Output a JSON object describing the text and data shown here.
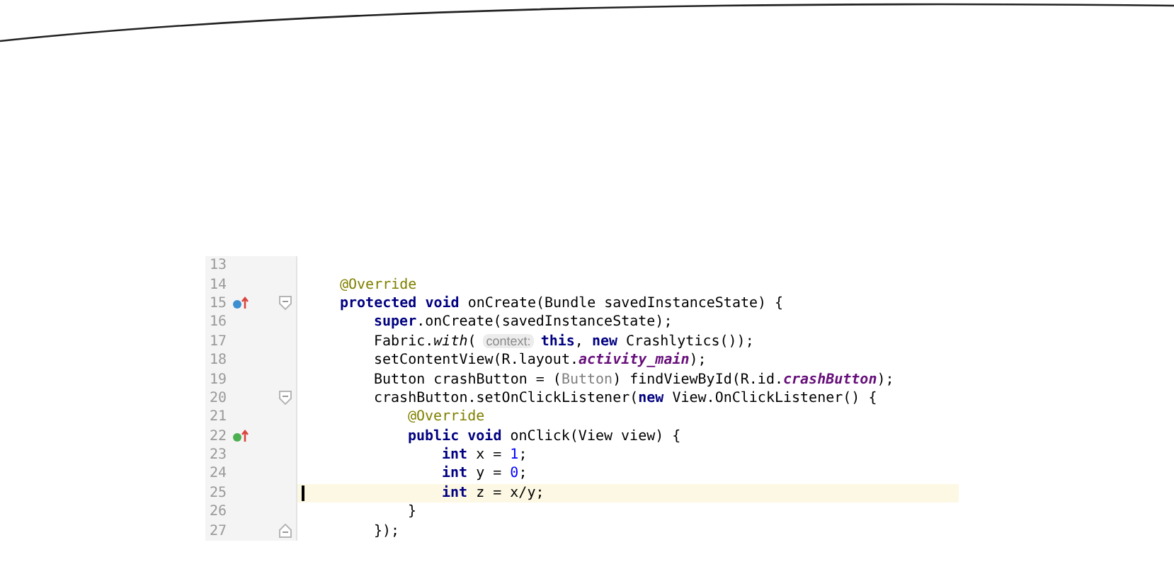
{
  "editor": {
    "lines": [
      {
        "number": "13",
        "current": false
      },
      {
        "number": "14",
        "current": false,
        "tokens": [
          {
            "kind": "annotation",
            "text": "@Override"
          }
        ]
      },
      {
        "number": "15",
        "current": false,
        "marker": {
          "color": "#3d8fd1"
        },
        "fold_marker": {
          "kind": "start"
        },
        "tokens": [
          {
            "kind": "keyword",
            "text": "protected void"
          },
          {
            "kind": "plain",
            "text": " onCreate(Bundle savedInstanceState) {"
          }
        ],
        "children": [
          {
            "number": "16",
            "current": false,
            "tokens": [
              {
                "kind": "keyword",
                "text": "super"
              },
              {
                "kind": "plain",
                "text": ".onCreate(savedInstanceState);"
              }
            ]
          },
          {
            "number": "17",
            "current": false,
            "tokens": [
              {
                "kind": "plain",
                "text": "Fabric."
              },
              {
                "kind": "static",
                "text": "with"
              },
              {
                "kind": "plain",
                "text": "("
              },
              {
                "kind": "hint",
                "text": "context:"
              },
              {
                "kind": "keyword",
                "text": "this"
              },
              {
                "kind": "plain",
                "text": ", "
              },
              {
                "kind": "keyword",
                "text": "new"
              },
              {
                "kind": "plain",
                "text": " Crashlytics());"
              }
            ]
          },
          {
            "number": "18",
            "current": false,
            "tokens": [
              {
                "kind": "plain",
                "text": "setContentView(R.layout."
              },
              {
                "kind": "field",
                "text": "activity_main"
              },
              {
                "kind": "plain",
                "text": ");"
              }
            ]
          },
          {
            "number": "19",
            "current": false,
            "tokens": [
              {
                "kind": "plain",
                "text": "Button crashButton = ("
              },
              {
                "kind": "muted",
                "text": "Button"
              },
              {
                "kind": "plain",
                "text": ") findViewById(R.id."
              },
              {
                "kind": "field",
                "text": "crashButton"
              },
              {
                "kind": "plain",
                "text": ");"
              }
            ]
          },
          {
            "number": "20",
            "current": false,
            "fold_marker": {
              "kind": "start"
            },
            "tokens": [
              {
                "kind": "plain",
                "text": "crashButton.setOnClickListener("
              },
              {
                "kind": "keyword",
                "text": "new"
              },
              {
                "kind": "plain",
                "text": " View.OnClickListener() {"
              }
            ],
            "children": [
              {
                "number": "21",
                "current": false,
                "tokens": [
                  {
                    "kind": "annotation",
                    "text": "@Override"
                  }
                ]
              },
              {
                "number": "22",
                "current": false,
                "marker": {
                  "color": "#4caf50"
                },
                "tokens": [
                  {
                    "kind": "keyword",
                    "text": "public void"
                  },
                  {
                    "kind": "plain",
                    "text": " onClick(View view) {"
                  }
                ],
                "children": [
                  {
                    "number": "23",
                    "current": false,
                    "tokens": [
                      {
                        "kind": "keyword",
                        "text": "int"
                      },
                      {
                        "kind": "plain",
                        "text": " x = "
                      },
                      {
                        "kind": "number",
                        "text": "1"
                      },
                      {
                        "kind": "plain",
                        "text": ";"
                      }
                    ]
                  },
                  {
                    "number": "24",
                    "current": false,
                    "tokens": [
                      {
                        "kind": "keyword",
                        "text": "int"
                      },
                      {
                        "kind": "plain",
                        "text": " y = "
                      },
                      {
                        "kind": "number",
                        "text": "0"
                      },
                      {
                        "kind": "plain",
                        "text": ";"
                      }
                    ]
                  },
                  {
                    "number": "25",
                    "current": true,
                    "tokens": [
                      {
                        "kind": "keyword",
                        "text": "int"
                      },
                      {
                        "kind": "plain",
                        "text": " z = x/y;"
                      }
                    ]
                  }
                ]
              },
              {
                "number": "26",
                "current": false,
                "tokens": [
                  {
                    "kind": "plain",
                    "text": "}"
                  }
                ]
              }
            ]
          },
          {
            "number": "27",
            "current": false,
            "fold_marker": {
              "kind": "end"
            },
            "tokens": [
              {
                "kind": "plain",
                "text": "});"
              }
            ]
          }
        ]
      }
    ]
  }
}
